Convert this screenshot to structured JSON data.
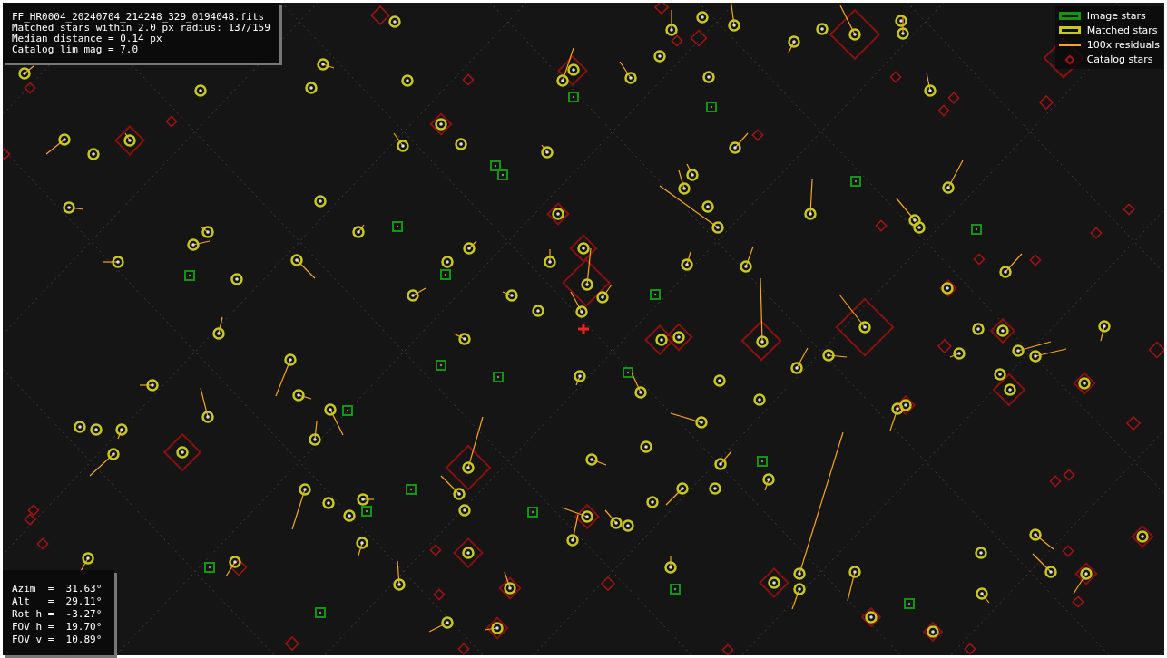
{
  "info_panel": {
    "lines": [
      "FF_HR0004_20240704_214248_329_0194048.fits",
      "Matched stars within 2.0 px radius: 137/159",
      "Median distance = 0.14 px",
      "Catalog lim mag = 7.0"
    ]
  },
  "legend": [
    {
      "kind": "box",
      "color": "#129612",
      "label": "Image stars"
    },
    {
      "kind": "box",
      "color": "#c8c81e",
      "label": "Matched stars"
    },
    {
      "kind": "line",
      "color": "#f5a623",
      "label": "100x residuals"
    },
    {
      "kind": "diamond",
      "color": "#a01414",
      "label": "Catalog stars"
    }
  ],
  "pointing_panel": {
    "lines": [
      "Azim  =  31.63°",
      "Alt   =  29.11°",
      "Rot h =  -3.27°",
      "FOV h =  19.70°",
      "FOV v =  10.89°"
    ]
  }
}
